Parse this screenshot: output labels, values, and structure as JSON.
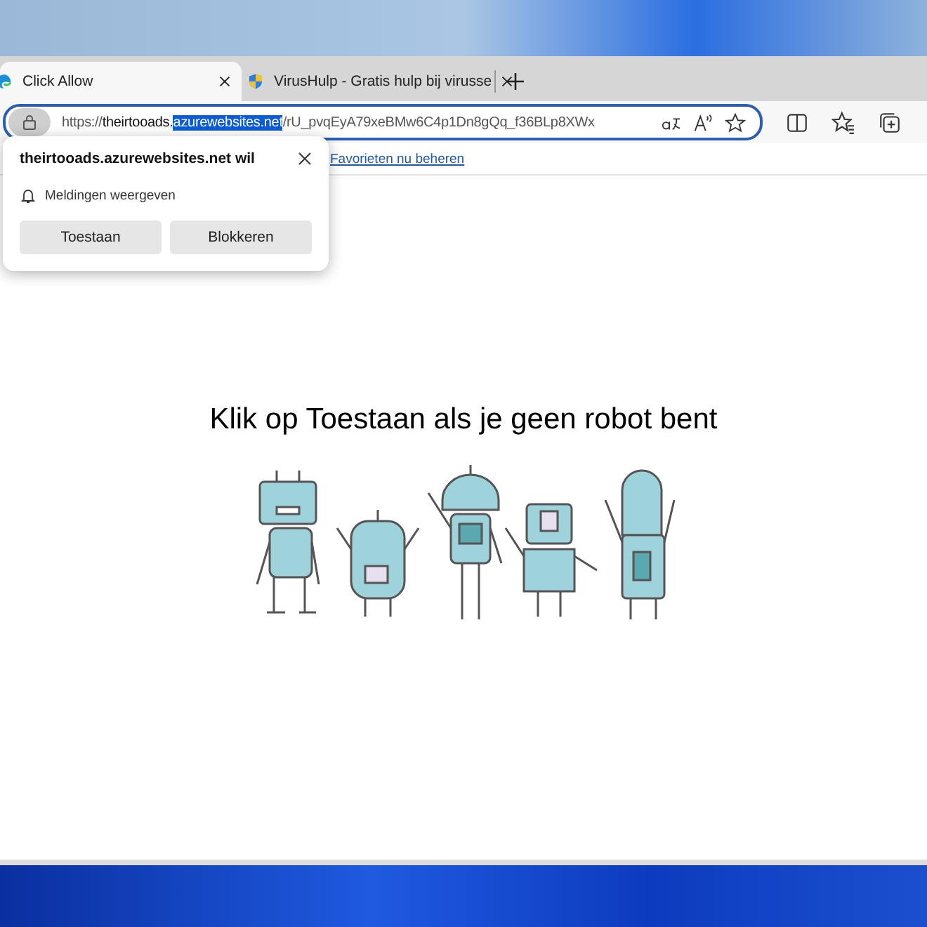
{
  "tabs": [
    {
      "title": "Click Allow",
      "selected": true,
      "kind": "edge"
    },
    {
      "title": "VirusHulp - Gratis hulp bij virusse",
      "selected": false,
      "kind": "shield"
    }
  ],
  "address_bar": {
    "parts": [
      {
        "text": "https://",
        "kind": "scheme",
        "selected": false
      },
      {
        "text": "theirtooads.",
        "kind": "host",
        "selected": false
      },
      {
        "text": "azurewebsites.net",
        "kind": "host",
        "selected": true
      },
      {
        "text": "/rU_pvqEyA79xeBMw6C4p1Dn8gQq_f36BLp8XWx",
        "kind": "path",
        "selected": false
      }
    ]
  },
  "favorites_bar": {
    "link": "Favorieten nu beheren"
  },
  "permission_popup": {
    "title": "theirtooads.azurewebsites.net wil",
    "permission": "Meldingen weergeven",
    "buttons": [
      "Toestaan",
      "Blokkeren"
    ]
  },
  "page": {
    "heading": "Klik op Toestaan als je geen robot bent"
  }
}
